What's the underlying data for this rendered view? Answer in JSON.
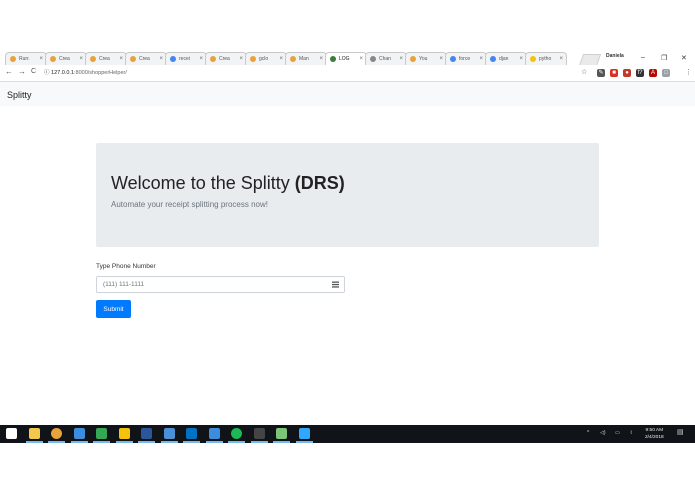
{
  "browser": {
    "tabs": [
      {
        "label": "Run:",
        "color": "#e8a33c"
      },
      {
        "label": "Crea",
        "color": "#e8a33c"
      },
      {
        "label": "Crea",
        "color": "#e8a33c"
      },
      {
        "label": "Crea",
        "color": "#e8a33c"
      },
      {
        "label": "recei",
        "color": "#4285f4"
      },
      {
        "label": "Crea",
        "color": "#e8a33c"
      },
      {
        "label": "gclo",
        "color": "#e8a33c"
      },
      {
        "label": "Man",
        "color": "#e8a33c"
      },
      {
        "label": "LOG",
        "color": "#3b7d3b",
        "active": true
      },
      {
        "label": "Chan",
        "color": "#888888"
      },
      {
        "label": "You",
        "color": "#e8a33c"
      },
      {
        "label": "force",
        "color": "#4285f4"
      },
      {
        "label": "djan",
        "color": "#4285f4"
      },
      {
        "label": "pytho",
        "color": "#f4c20d"
      }
    ],
    "tab_close_glyph": "×",
    "profile_name": "Daniela",
    "window_controls": {
      "minimize": "–",
      "maximize": "❐",
      "close": "✕"
    },
    "nav": {
      "back": "←",
      "forward": "→",
      "reload": "C",
      "info": "ⓘ"
    },
    "url_host": "127.0.0.1",
    "url_path": ":8000/shopperHelper/",
    "star": "☆",
    "extensions": [
      {
        "name": "eyedropper-extension-icon",
        "color": "#555555",
        "glyph": "✎"
      },
      {
        "name": "adblock-extension-icon",
        "color": "#d93025",
        "glyph": "■"
      },
      {
        "name": "shield-extension-icon",
        "color": "#c0392b",
        "glyph": "●"
      },
      {
        "name": "function-extension-icon",
        "color": "#333333",
        "glyph": "f?"
      },
      {
        "name": "acrobat-extension-icon",
        "color": "#b30b00",
        "glyph": "A"
      },
      {
        "name": "square-extension-icon",
        "color": "#9aa0a6",
        "glyph": "□"
      }
    ],
    "menu": "⋮"
  },
  "app": {
    "brand": "Splitty",
    "jumbotron": {
      "title_text": "Welcome to the Splitty ",
      "title_bold": "(DRS)",
      "subtitle": "Automate your receipt splitting process now!"
    },
    "form": {
      "label": "Type Phone Number",
      "placeholder": "(111) 111-1111",
      "submit_label": "Submit"
    },
    "colors": {
      "primary": "#007bff",
      "jumbotron_bg": "#e9ecef",
      "navbar_bg": "#f8f9fa"
    }
  },
  "taskbar": {
    "apps": [
      {
        "name": "start-icon",
        "color": "#ffffff"
      },
      {
        "name": "file-explorer-icon",
        "color": "#f2c94c"
      },
      {
        "name": "chrome-icon",
        "color": "#e8a33c"
      },
      {
        "name": "store-icon",
        "color": "#3c8dde"
      },
      {
        "name": "app-green-icon",
        "color": "#34a853"
      },
      {
        "name": "app-hamster-icon",
        "color": "#f4c20d"
      },
      {
        "name": "word-icon",
        "color": "#2b579a"
      },
      {
        "name": "remote-icon",
        "color": "#4a90d9"
      },
      {
        "name": "outlook-icon",
        "color": "#0072c6"
      },
      {
        "name": "app-blue-icon",
        "color": "#3c8dde"
      },
      {
        "name": "spotify-icon",
        "color": "#1db954"
      },
      {
        "name": "terminal-icon",
        "color": "#444444"
      },
      {
        "name": "notepad-icon",
        "color": "#7cc576"
      },
      {
        "name": "photoshop-icon",
        "color": "#31a8ff"
      }
    ],
    "tray": {
      "up": "^",
      "speaker": "◁)",
      "battery": "▭",
      "network": "⌇"
    },
    "time": "9:50 AM",
    "date": "2/4/2018",
    "notifications": "▤"
  }
}
